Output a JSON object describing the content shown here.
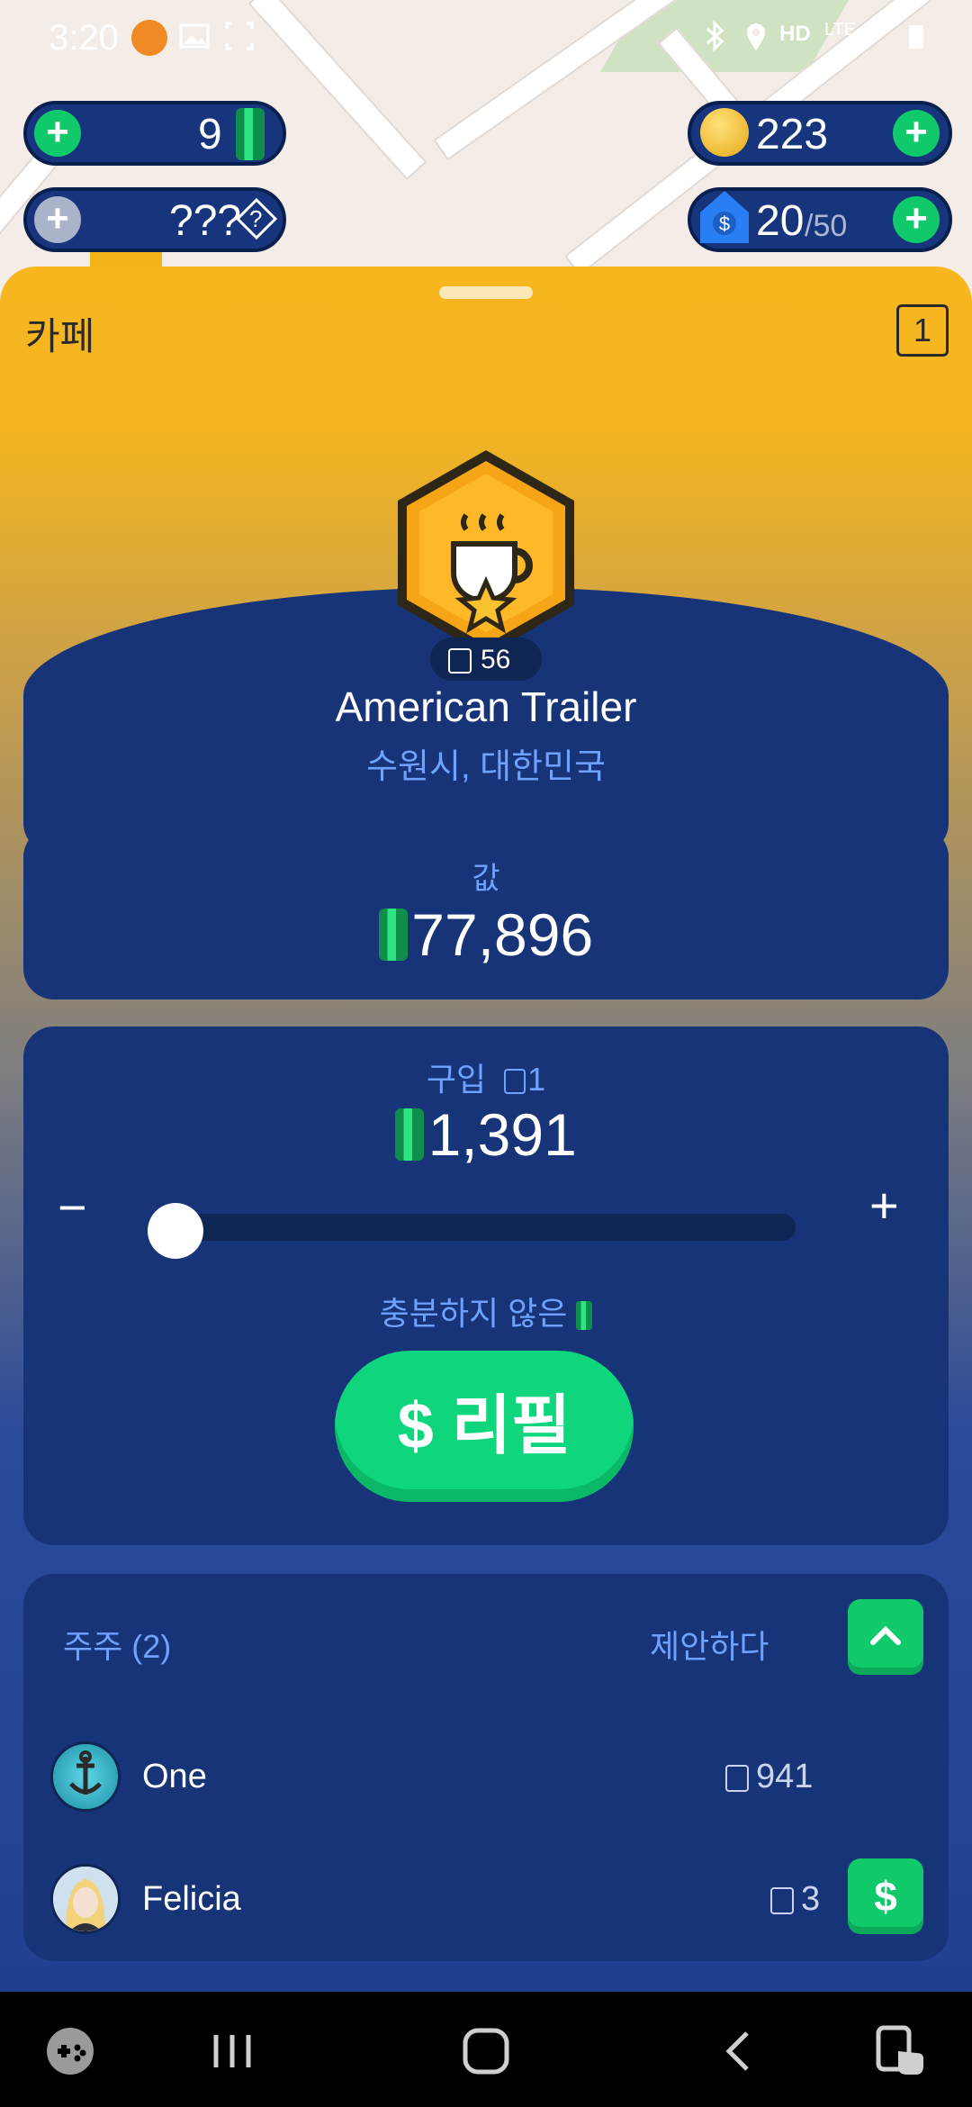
{
  "status_bar": {
    "time": "3:20",
    "network": "HD",
    "network_type": "LTE"
  },
  "hud": {
    "cash_value": "9",
    "unknown_value": "???",
    "unknown_badge": "?",
    "coins_value": "223",
    "properties_value": "20",
    "properties_max": "/50"
  },
  "sheet": {
    "title": "카페",
    "level": "1",
    "badge_count": "56",
    "business_name": "American Trailer",
    "location": "수원시, 대한민국"
  },
  "value_card": {
    "label": "값",
    "amount": "77,896"
  },
  "purchase_card": {
    "label": "구입",
    "share_count": "1",
    "price": "1,391",
    "minus_label": "−",
    "plus_label": "+",
    "slider_fraction": 0.0,
    "insufficient_text": "충분하지 않은",
    "refill_label": "$ 리필"
  },
  "shareholders": {
    "title": "주주 (2)",
    "offer_label": "제안하다",
    "rows": [
      {
        "name": "One",
        "shares": "941"
      },
      {
        "name": "Felicia",
        "shares": "3",
        "action_label": "$"
      }
    ]
  },
  "colors": {
    "accent_green": "#10c96a",
    "card_blue": "#163477",
    "label_blue": "#6fa1ff",
    "sheet_yellow": "#f8b71f"
  }
}
